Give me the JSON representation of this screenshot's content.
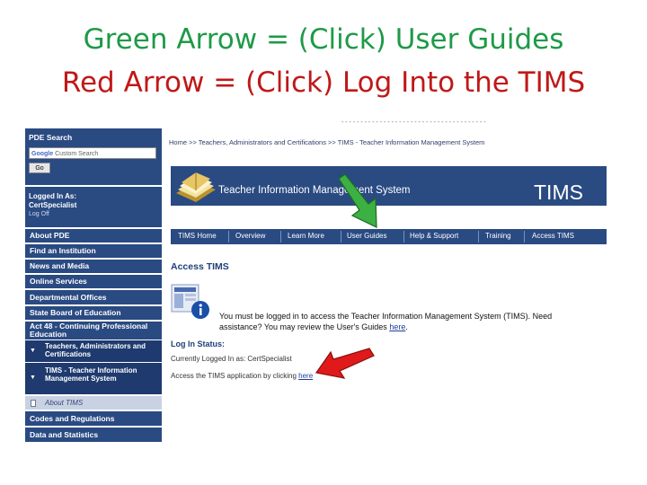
{
  "slide": {
    "line_green": "Green Arrow = (Click) User Guides",
    "line_red": "Red Arrow = (Click) Log Into the TIMS",
    "green_color": "#1e9a48",
    "red_color": "#c01818"
  },
  "sidebar": {
    "search_title": "PDE Search",
    "search_google": "Google",
    "search_placeholder": "Custom Search",
    "go_label": "Go",
    "logged_in_label": "Logged In As:",
    "logged_in_user": "CertSpecialist",
    "log_off": "Log Off",
    "items": [
      "About PDE",
      "Find an Institution",
      "News and Media",
      "Online Services",
      "Departmental Offices",
      "State Board of Education",
      "Act 48 - Continuing Professional Education"
    ],
    "sub_items": [
      "Teachers, Administrators and Certifications",
      "TIMS - Teacher Information Management System"
    ],
    "current_item": "About TIMS",
    "bottom_items": [
      "Codes and Regulations",
      "Data and Statistics"
    ]
  },
  "main": {
    "breadcrumb": "Home >> Teachers, Administrators and Certifications >> TIMS - Teacher Information Management System",
    "banner_title": "Teacher Information Management System",
    "banner_acronym": "TIMS",
    "nav": [
      "TIMS Home",
      "Overview",
      "Learn More",
      "User Guides",
      "Help & Support",
      "Training",
      "Access TIMS"
    ],
    "access_heading": "Access TIMS",
    "message_line1": "You must be logged in to access the Teacher Information Management System (TIMS). Need",
    "message_line2_pre": "assistance? You may review the User's Guides ",
    "message_line2_link": "here",
    "message_line2_post": ".",
    "status_heading": "Log In Status:",
    "status_text": "Currently Logged In as: CertSpecialist",
    "access_pre": "Access the TIMS application by clicking ",
    "access_link": "here"
  }
}
